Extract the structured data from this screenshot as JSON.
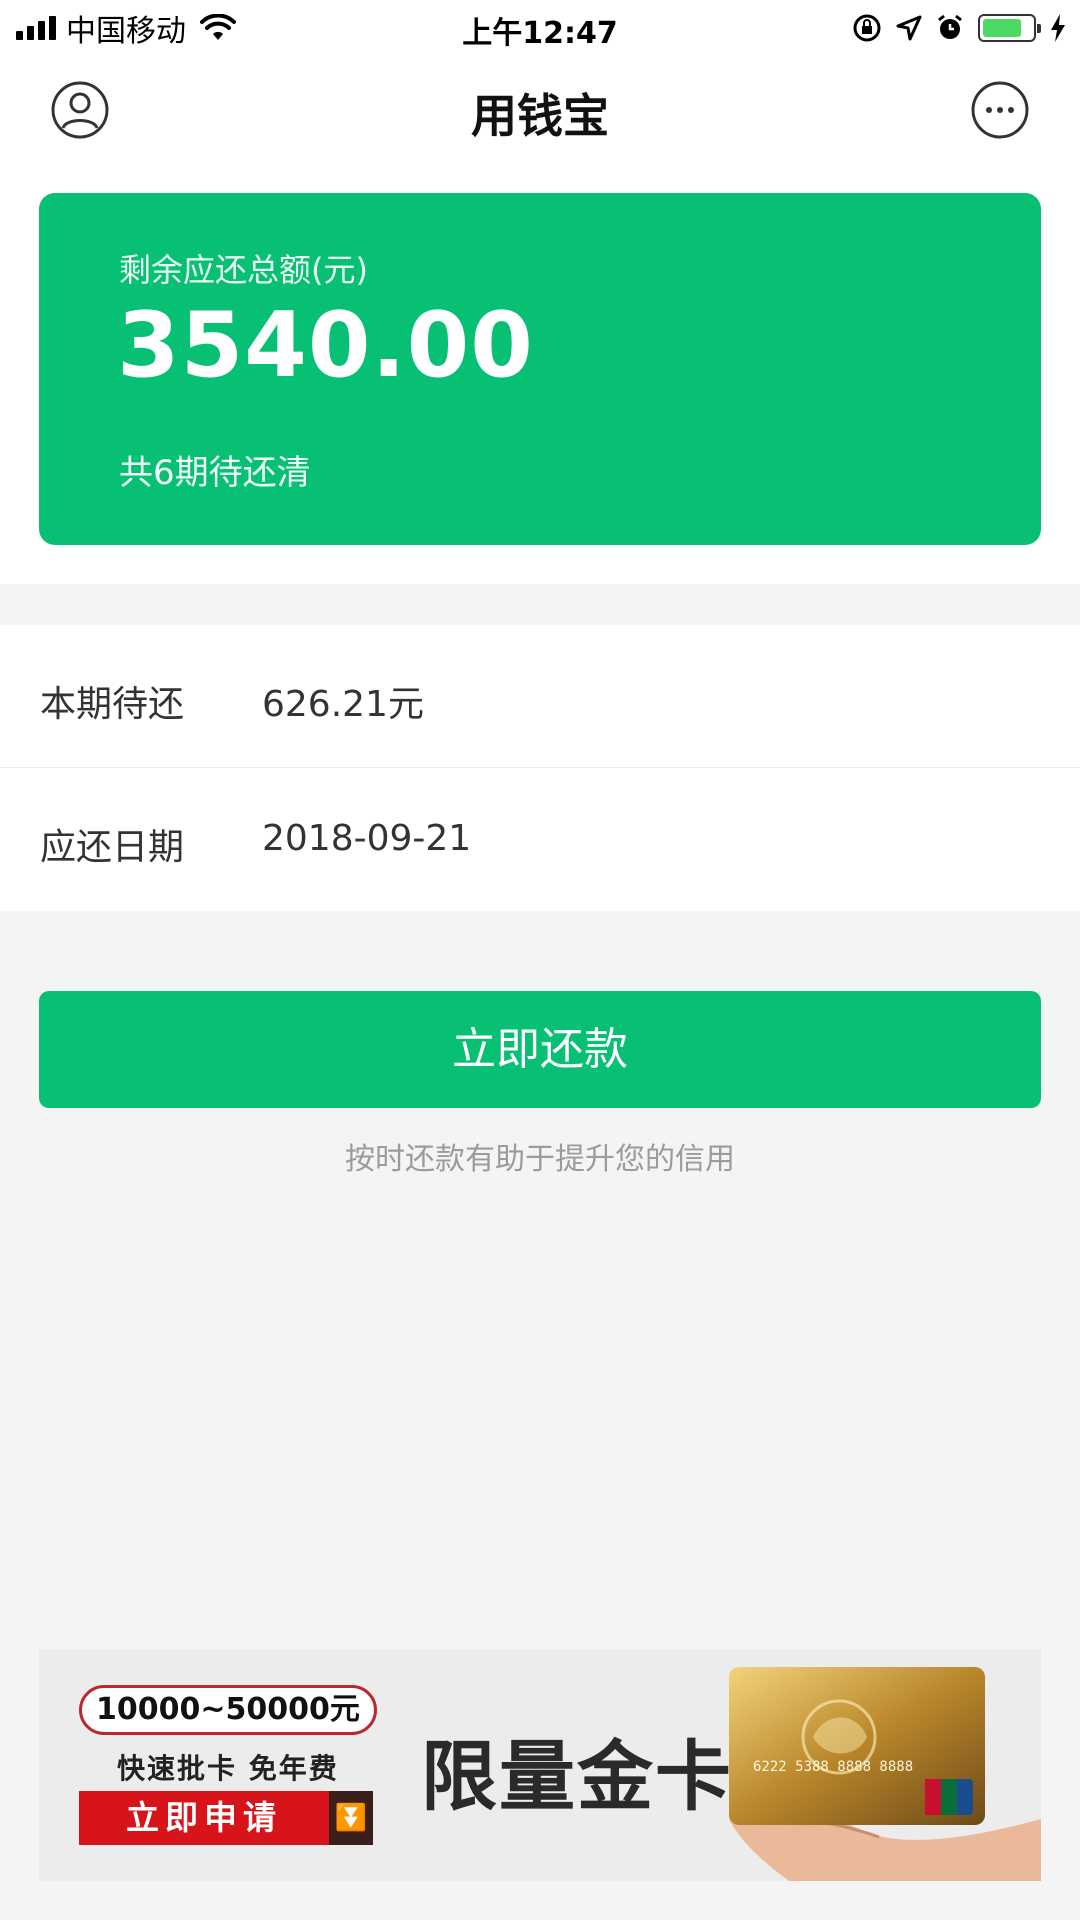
{
  "status_bar": {
    "carrier": "中国移动",
    "time": "上午12:47",
    "battery_level": 0.7
  },
  "nav": {
    "title": "用钱宝",
    "left_icon": "user-circle-icon",
    "right_icon": "more-dots-icon"
  },
  "summary": {
    "label": "剩余应还总额(元)",
    "amount": "3540.00",
    "periods_text": "共6期待还清",
    "background": "#07c073"
  },
  "details": [
    {
      "label": "本期待还",
      "value": "626.21元"
    },
    {
      "label": "应还日期",
      "value": "2018-09-21"
    }
  ],
  "repay_button": {
    "label": "立即还款",
    "color": "#07c073"
  },
  "tip": "按时还款有助于提升您的信用",
  "banner": {
    "amount_range": "10000~50000元",
    "subtitle": "快速批卡 免年费",
    "apply_label": "立即申请",
    "headline": "限量金卡",
    "card_number": "6222 5388 8888 8888"
  }
}
